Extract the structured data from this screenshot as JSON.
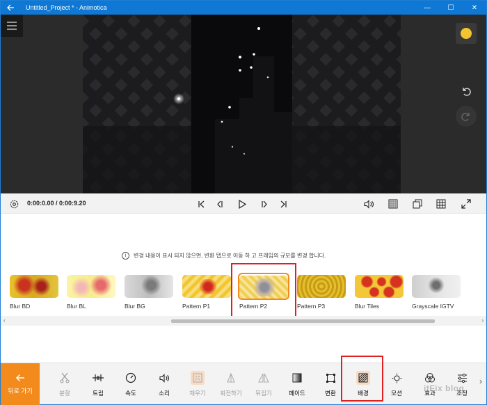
{
  "window": {
    "title": "Untitled_Project * - Animotica",
    "minimize": "—",
    "maximize": "☐",
    "close": "✕"
  },
  "timeline": {
    "time": "0:00:0.00 / 0:00:9.20"
  },
  "info_text": "변경 내용이 표시 되지 않으면, 변환 탭으로 이동 하 고 프레임의 규모를 변경 합니다.",
  "backgrounds": [
    {
      "label": "Blur BD"
    },
    {
      "label": "Blur BL"
    },
    {
      "label": "Blur BG"
    },
    {
      "label": "Pattern P1"
    },
    {
      "label": "Pattern P2",
      "selected": true
    },
    {
      "label": "Pattern P3"
    },
    {
      "label": "Blur Tiles"
    },
    {
      "label": "Grayscale IGTV"
    }
  ],
  "toolbar": {
    "back_label": "뒤로 가기",
    "tools": [
      {
        "label": "분할",
        "icon": "scissors-icon",
        "disabled": true
      },
      {
        "label": "트림",
        "icon": "trim-icon"
      },
      {
        "label": "속도",
        "icon": "speed-icon"
      },
      {
        "label": "소리",
        "icon": "volume-icon"
      },
      {
        "label": "채우기",
        "icon": "fill-icon",
        "disabled": true
      },
      {
        "label": "회전하기",
        "icon": "rotate-icon",
        "disabled": true
      },
      {
        "label": "뒤집기",
        "icon": "flip-icon",
        "disabled": true
      },
      {
        "label": "페이드",
        "icon": "fade-icon"
      },
      {
        "label": "변환",
        "icon": "transform-icon"
      },
      {
        "label": "배경",
        "icon": "background-icon",
        "selected": true
      },
      {
        "label": "모션",
        "icon": "motion-icon"
      },
      {
        "label": "효과",
        "icon": "effects-icon"
      },
      {
        "label": "조정",
        "icon": "adjust-icon"
      }
    ]
  },
  "watermark": "itFix blog",
  "colors": {
    "titlebar": "#0e78d4",
    "accent": "#f38a1c",
    "highlight": "#e02020"
  }
}
